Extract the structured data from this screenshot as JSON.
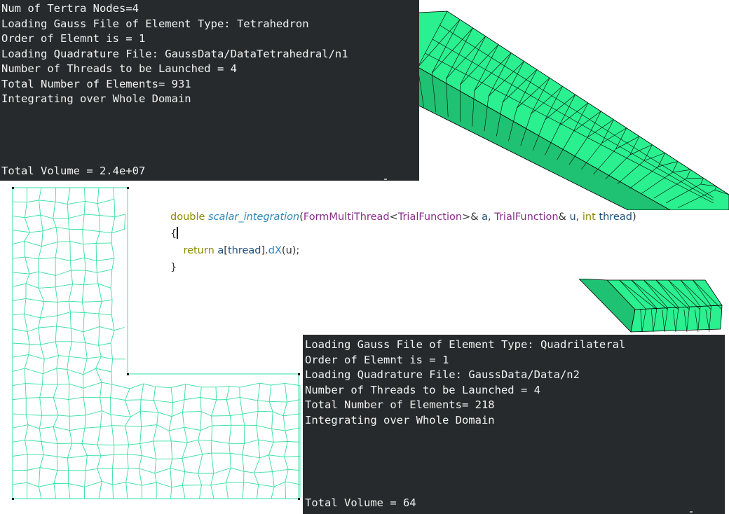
{
  "top_terminal": {
    "lines": [
      "Num of Tertra Nodes=4",
      "Loading Gauss File of Element Type: Tetrahedron",
      "Order of Elemnt is = 1",
      "Loading Quadrature File: GaussData/DataTetrahedral/n1",
      "Number of Threads to be Launched = 4",
      "Total Number of Elements= 931",
      "Integrating over Whole Domain"
    ],
    "total": "Total Volume = 2.4e+07"
  },
  "code_editor": {
    "line1": {
      "kw_double": "double",
      "fn_name": "scalar_integration",
      "open_paren": "(",
      "type_form": "FormMultiThread",
      "lt": "<",
      "type_trial": "TrialFunction",
      "gt_amp": ">& ",
      "param_a": "a",
      "comma1": ", ",
      "type_trial2": "TrialFunction",
      "amp": "& ",
      "param_u": "u",
      "comma2": ", ",
      "kw_int": "int",
      "space": " ",
      "param_thread": "thread",
      "close_paren": ")"
    },
    "line2": "{",
    "line3": {
      "indent": "    ",
      "kw_return": "return",
      "space": " ",
      "var_a": "a",
      "lb": "[",
      "idx": "thread",
      "rb_dot": "].",
      "method": "dX",
      "args": "(u);"
    },
    "line4": "}"
  },
  "bottom_terminal": {
    "lines": [
      "Loading Gauss File of Element Type: Quadrilateral",
      "Order of Elemnt is = 1",
      "Loading Quadrature File: GaussData/Data/n2",
      "Number of Threads to be Launched = 4",
      "Total Number of Elements= 218",
      "Integrating over Whole Domain"
    ],
    "total": "Total Volume = 64"
  },
  "colors": {
    "terminal_bg": "#262a2c",
    "terminal_text": "#f2f2f2",
    "mesh_fill": "#2af090",
    "mesh_edge": "#000000",
    "lmesh_line": "#33e0a0"
  }
}
